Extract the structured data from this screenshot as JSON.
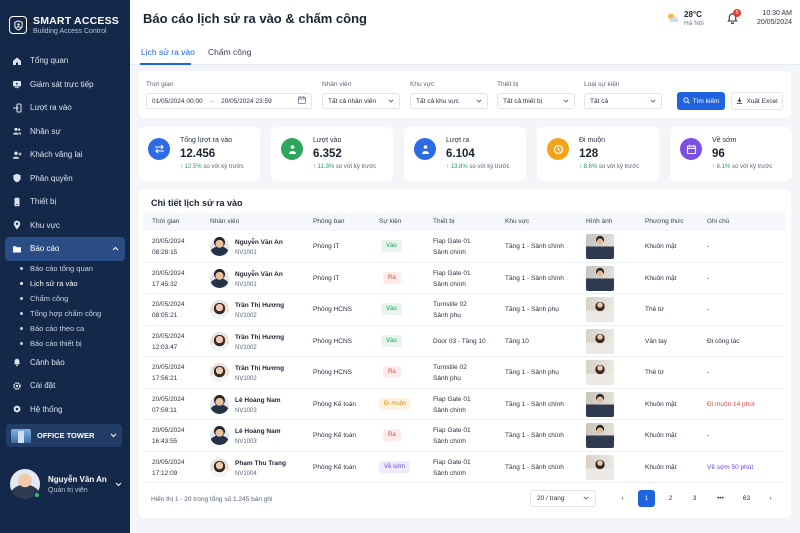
{
  "brand": {
    "title": "SMART ACCESS",
    "subtitle": "Building Access Control",
    "logo_icon": "shield-user-icon"
  },
  "sidebar": {
    "items": [
      {
        "label": "Tổng quan",
        "icon": "home-icon"
      },
      {
        "label": "Giám sát trực tiếp",
        "icon": "monitor-icon"
      },
      {
        "label": "Lượt ra vào",
        "icon": "enter-icon"
      },
      {
        "label": "Nhân sự",
        "icon": "users-icon"
      },
      {
        "label": "Khách vãng lai",
        "icon": "user-plus-icon"
      },
      {
        "label": "Phân quyền",
        "icon": "shield-icon"
      },
      {
        "label": "Thiết bị",
        "icon": "device-icon"
      },
      {
        "label": "Khu vực",
        "icon": "location-icon"
      },
      {
        "label": "Báo cáo",
        "icon": "folder-icon",
        "active": true
      }
    ],
    "report_sub": [
      {
        "label": "Báo cáo tổng quan"
      },
      {
        "label": "Lịch sử ra vào",
        "active": true
      },
      {
        "label": "Chấm công"
      },
      {
        "label": "Tổng hợp chấm công"
      },
      {
        "label": "Báo cáo theo ca"
      },
      {
        "label": "Báo cáo thiết bị"
      }
    ],
    "bottom_items": [
      {
        "label": "Cảnh báo",
        "icon": "bell-icon"
      },
      {
        "label": "Cài đặt",
        "icon": "gear-icon"
      },
      {
        "label": "Hệ thống",
        "icon": "settings-icon"
      }
    ],
    "building": "OFFICE TOWER",
    "user": {
      "name": "Nguyễn Văn An",
      "role": "Quản trị viên"
    }
  },
  "header": {
    "title": "Báo cáo lịch sử ra vào & chấm công",
    "weather": {
      "temp": "28°C",
      "location": "Hà Nội"
    },
    "notifications": "5",
    "time": "10:30 AM",
    "date": "20/05/2024"
  },
  "tabs": [
    {
      "label": "Lịch sử ra vào",
      "active": true
    },
    {
      "label": "Chấm công"
    }
  ],
  "filters": {
    "time_label": "Thời gian",
    "time_from": "01/05/2024 00:00",
    "time_sep": "→",
    "time_to": "20/05/2024 23:59",
    "employee_label": "Nhân viên",
    "employee_value": "Tất cả nhân viên",
    "area_label": "Khu vực",
    "area_value": "Tất cả khu vực",
    "device_label": "Thiết bị",
    "device_value": "Tất cả thiết bị",
    "event_label": "Loại sự kiện",
    "event_value": "Tất cả",
    "search_button": "Tìm kiếm",
    "export_button": "Xuất Excel"
  },
  "stats": [
    {
      "label": "Tổng lượt ra vào",
      "value": "12.456",
      "trend": "↑ 12.5%",
      "trend_suffix": "so với kỳ trước",
      "color": "#2d6be4",
      "icon": "swap-icon"
    },
    {
      "label": "Lượt vào",
      "value": "6.352",
      "trend": "↑ 11.3%",
      "trend_suffix": "so với kỳ trước",
      "color": "#2ea65c",
      "icon": "enter-person-icon"
    },
    {
      "label": "Lượt ra",
      "value": "6.104",
      "trend": "↑ 13.8%",
      "trend_suffix": "so với kỳ trước",
      "color": "#2d6be4",
      "icon": "exit-person-icon"
    },
    {
      "label": "Đi muộn",
      "value": "128",
      "trend": "↑ 8.6%",
      "trend_suffix": "so với kỳ trước",
      "color": "#f5a21b",
      "icon": "clock-icon"
    },
    {
      "label": "Về sớm",
      "value": "96",
      "trend": "↑ 6.1%",
      "trend_suffix": "so với kỳ trước",
      "color": "#7b4fe0",
      "icon": "calendar-icon"
    }
  ],
  "table": {
    "title": "Chi tiết lịch sử ra vào",
    "headers": [
      "Thời gian",
      "Nhân viên",
      "Phòng ban",
      "Sự kiện",
      "Thiết bị",
      "Khu vực",
      "Hình ảnh",
      "Phương thức",
      "Ghi chú"
    ],
    "rows": [
      {
        "date": "20/05/2024",
        "time": "08:28:15",
        "name": "Nguyễn Văn An",
        "id": "NV1001",
        "gender": "m",
        "dept": "Phòng IT",
        "event": "Vào",
        "event_type": "vao",
        "device": "Flap Gate 01",
        "device_loc": "Sảnh chính",
        "area": "Tầng 1 - Sảnh chính",
        "method": "Khuôn mặt",
        "note": "-",
        "note_type": ""
      },
      {
        "date": "20/05/2024",
        "time": "17:45:32",
        "name": "Nguyễn Văn An",
        "id": "NV1001",
        "gender": "m",
        "dept": "Phòng IT",
        "event": "Ra",
        "event_type": "ra",
        "device": "Flap Gate 01",
        "device_loc": "Sảnh chính",
        "area": "Tầng 1 - Sảnh chính",
        "method": "Khuôn mặt",
        "note": "-",
        "note_type": ""
      },
      {
        "date": "20/05/2024",
        "time": "08:05:21",
        "name": "Trần Thị Hương",
        "id": "NV1002",
        "gender": "f",
        "dept": "Phòng HCNS",
        "event": "Vào",
        "event_type": "vao",
        "device": "Turnstile 02",
        "device_loc": "Sảnh phụ",
        "area": "Tầng 1 - Sảnh phụ",
        "method": "Thẻ từ",
        "note": "-",
        "note_type": ""
      },
      {
        "date": "20/05/2024",
        "time": "12:03:47",
        "name": "Trần Thị Hương",
        "id": "NV1002",
        "gender": "f",
        "dept": "Phòng HCNS",
        "event": "Vào",
        "event_type": "vao",
        "device": "Door 03 - Tầng 10",
        "device_loc": "",
        "area": "Tầng 10",
        "method": "Vân tay",
        "note": "Đi công tác",
        "note_type": ""
      },
      {
        "date": "20/05/2024",
        "time": "17:56:21",
        "name": "Trần Thị Hương",
        "id": "NV1002",
        "gender": "f",
        "dept": "Phòng HCNS",
        "event": "Ra",
        "event_type": "ra",
        "device": "Turnstile 02",
        "device_loc": "Sảnh phụ",
        "area": "Tầng 1 - Sảnh phụ",
        "method": "Thẻ từ",
        "note": "-",
        "note_type": ""
      },
      {
        "date": "20/05/2024",
        "time": "07:59:11",
        "name": "Lê Hoàng Nam",
        "id": "NV1003",
        "gender": "m",
        "dept": "Phòng Kế toán",
        "event": "Đi muộn",
        "event_type": "muon",
        "device": "Flap Gate 01",
        "device_loc": "Sảnh chính",
        "area": "Tầng 1 - Sảnh chính",
        "method": "Khuôn mặt",
        "note": "Đi muộn 14 phút",
        "note_type": "red"
      },
      {
        "date": "20/05/2024",
        "time": "16:43:55",
        "name": "Lê Hoàng Nam",
        "id": "NV1003",
        "gender": "m",
        "dept": "Phòng Kế toán",
        "event": "Ra",
        "event_type": "ra",
        "device": "Flap Gate 01",
        "device_loc": "Sảnh chính",
        "area": "Tầng 1 - Sảnh chính",
        "method": "Khuôn mặt",
        "note": "-",
        "note_type": ""
      },
      {
        "date": "20/05/2024",
        "time": "17:12:09",
        "name": "Phạm Thu Trang",
        "id": "NV1004",
        "gender": "f",
        "dept": "Phòng Kế toán",
        "event": "Về sớm",
        "event_type": "som",
        "device": "Flap Gate 01",
        "device_loc": "Sảnh chính",
        "area": "Tầng 1 - Sảnh chính",
        "method": "Khuôn mặt",
        "note": "Về sớm 50 phút",
        "note_type": "purple"
      }
    ]
  },
  "pagination": {
    "info": "Hiển thị 1 - 20 trong tổng số 1.245 bản ghi",
    "per_page": "20 / trang",
    "prev": "‹",
    "pages": [
      "1",
      "2",
      "3",
      "•••",
      "63"
    ],
    "current": "1",
    "next": "›"
  }
}
